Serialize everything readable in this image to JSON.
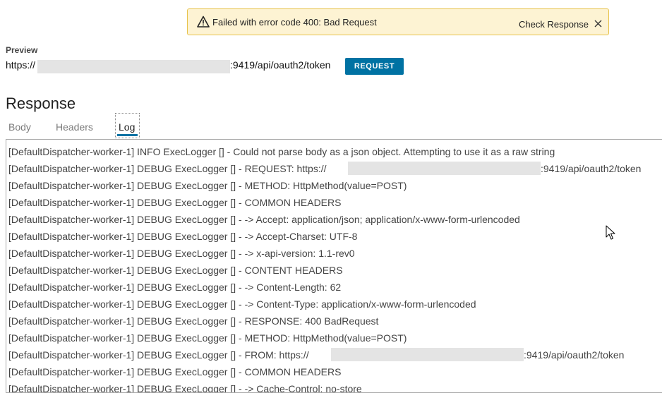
{
  "alert": {
    "message": "Failed with error code 400: Bad Request",
    "action_label": "Check Response",
    "icon": "warning-icon",
    "close_icon": "close-icon",
    "background": "#fdf3d3",
    "border": "#e7c34b"
  },
  "preview": {
    "label": "Preview",
    "url_prefix": "https://",
    "url_suffix": ":9419/api/oauth2/token",
    "request_button": "REQUEST"
  },
  "response": {
    "title": "Response",
    "tabs": [
      {
        "label": "Body",
        "active": false
      },
      {
        "label": "Headers",
        "active": false
      },
      {
        "label": "Log",
        "active": true
      }
    ]
  },
  "log": {
    "lines": [
      {
        "text": "[DefaultDispatcher-worker-1] INFO  ExecLogger [] - Could not parse body as a json object. Attempting to use it as a raw string"
      },
      {
        "text": "[DefaultDispatcher-worker-1] DEBUG ExecLogger [] - REQUEST: https://",
        "suffix": ":9419/api/oauth2/token",
        "redacted": true
      },
      {
        "text": "[DefaultDispatcher-worker-1] DEBUG ExecLogger [] - METHOD: HttpMethod(value=POST)"
      },
      {
        "text": "[DefaultDispatcher-worker-1] DEBUG ExecLogger [] - COMMON HEADERS"
      },
      {
        "text": "[DefaultDispatcher-worker-1] DEBUG ExecLogger [] - -> Accept: application/json; application/x-www-form-urlencoded"
      },
      {
        "text": "[DefaultDispatcher-worker-1] DEBUG ExecLogger [] - -> Accept-Charset: UTF-8"
      },
      {
        "text": "[DefaultDispatcher-worker-1] DEBUG ExecLogger [] - -> x-api-version: 1.1-rev0"
      },
      {
        "text": "[DefaultDispatcher-worker-1] DEBUG ExecLogger [] - CONTENT HEADERS"
      },
      {
        "text": "[DefaultDispatcher-worker-1] DEBUG ExecLogger [] - -> Content-Length: 62"
      },
      {
        "text": "[DefaultDispatcher-worker-1] DEBUG ExecLogger [] - -> Content-Type: application/x-www-form-urlencoded"
      },
      {
        "text": "[DefaultDispatcher-worker-1] DEBUG ExecLogger [] - RESPONSE: 400 BadRequest"
      },
      {
        "text": "[DefaultDispatcher-worker-1] DEBUG ExecLogger [] - METHOD: HttpMethod(value=POST)"
      },
      {
        "text": "[DefaultDispatcher-worker-1] DEBUG ExecLogger [] - FROM: https://",
        "suffix": ":9419/api/oauth2/token",
        "redacted": true
      },
      {
        "text": "[DefaultDispatcher-worker-1] DEBUG ExecLogger [] - COMMON HEADERS"
      },
      {
        "text": "[DefaultDispatcher-worker-1] DEBUG ExecLogger [] - -> Cache-Control: no-store"
      }
    ]
  },
  "colors": {
    "accent": "#0072a3",
    "log_text": "#444444"
  }
}
